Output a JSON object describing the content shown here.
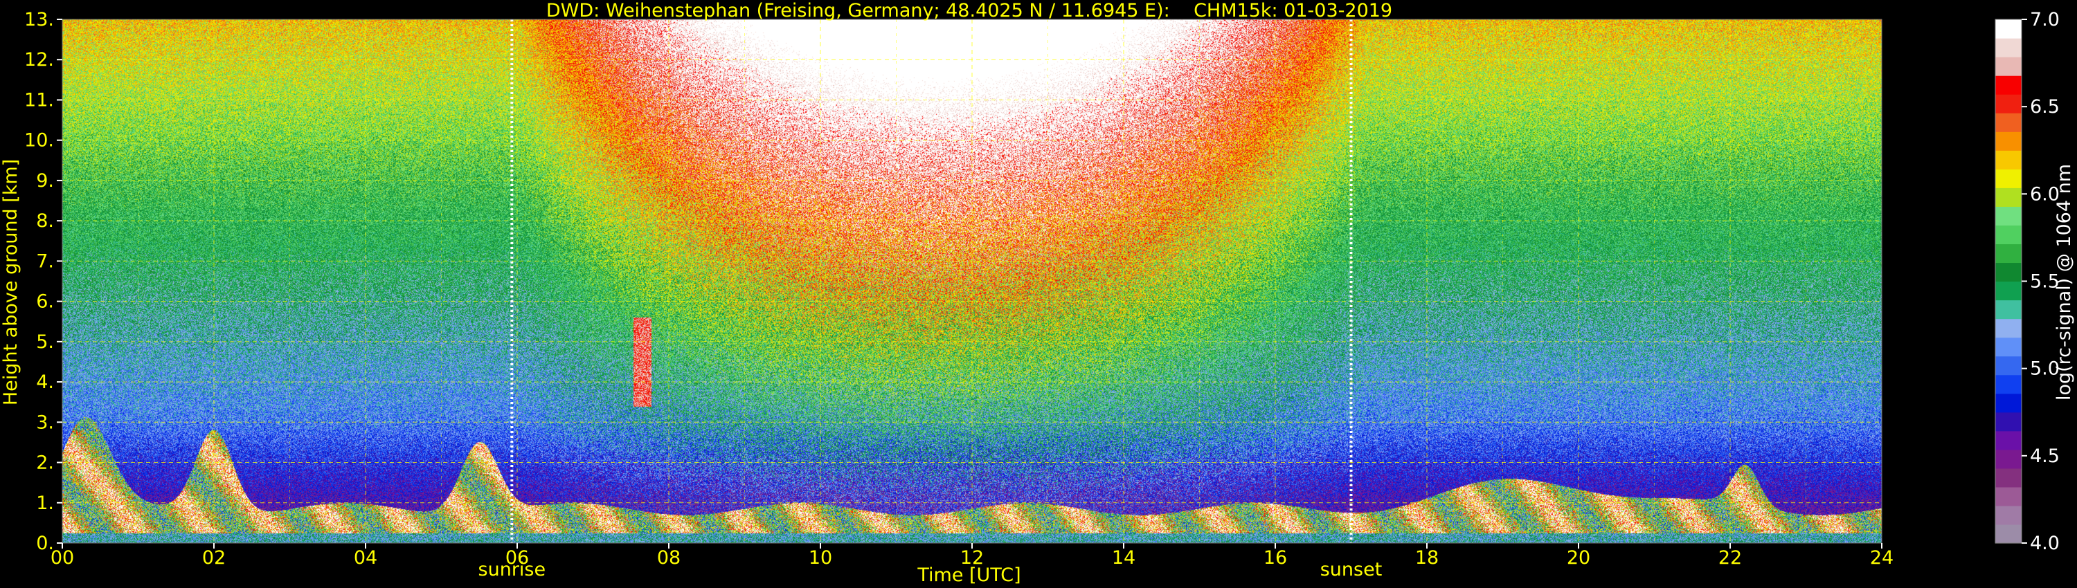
{
  "chart_data": {
    "type": "heatmap",
    "title": "DWD: Weihenstephan (Freising, Germany; 48.4025 N / 11.6945 E):    CHM15k: 01-03-2019",
    "xlabel": "Time [UTC]",
    "ylabel": "Height above ground [km]",
    "colorbar_label": "log(rc-signal) @ 1064 nm",
    "xlim": [
      0,
      24
    ],
    "ylim": [
      0,
      13
    ],
    "x_ticks": [
      0,
      2,
      4,
      6,
      8,
      10,
      12,
      14,
      16,
      18,
      20,
      22,
      24
    ],
    "x_tick_labels": [
      "00",
      "02",
      "04",
      "06",
      "08",
      "10",
      "12",
      "14",
      "16",
      "18",
      "20",
      "22",
      "24"
    ],
    "y_ticks": [
      0,
      1,
      2,
      3,
      4,
      5,
      6,
      7,
      8,
      9,
      10,
      11,
      12,
      13
    ],
    "y_tick_labels": [
      "0.",
      "1.",
      "2.",
      "3.",
      "4.",
      "5.",
      "6.",
      "7.",
      "8.",
      "9.",
      "10.",
      "11.",
      "12.",
      "13."
    ],
    "colorbar_range": [
      4.0,
      7.0
    ],
    "colorbar_ticks": [
      4.0,
      4.5,
      5.0,
      5.5,
      6.0,
      6.5,
      7.0
    ],
    "colorbar_tick_labels": [
      "4.0",
      "4.5",
      "5.0",
      "5.5",
      "6.0",
      "6.5",
      "7.0"
    ],
    "colorbar_colors": [
      "#9c8ca8",
      "#a07ba6",
      "#9c5a96",
      "#84307f",
      "#7a1990",
      "#6a10a8",
      "#3010b0",
      "#0018d8",
      "#1040f0",
      "#3568f0",
      "#6090f8",
      "#90b0f0",
      "#40c0a0",
      "#10a050",
      "#108830",
      "#30b040",
      "#50d060",
      "#70e080",
      "#b0e020",
      "#f0f000",
      "#f8c800",
      "#f89000",
      "#f06020",
      "#f02010",
      "#f80000",
      "#e8b8b4",
      "#f0d8d4",
      "#ffffff"
    ],
    "annotations": [
      {
        "text": "sunrise",
        "x": 5.93
      },
      {
        "text": "sunset",
        "x": 17.0
      }
    ],
    "grid": true,
    "grid_color": "#ffff00"
  }
}
